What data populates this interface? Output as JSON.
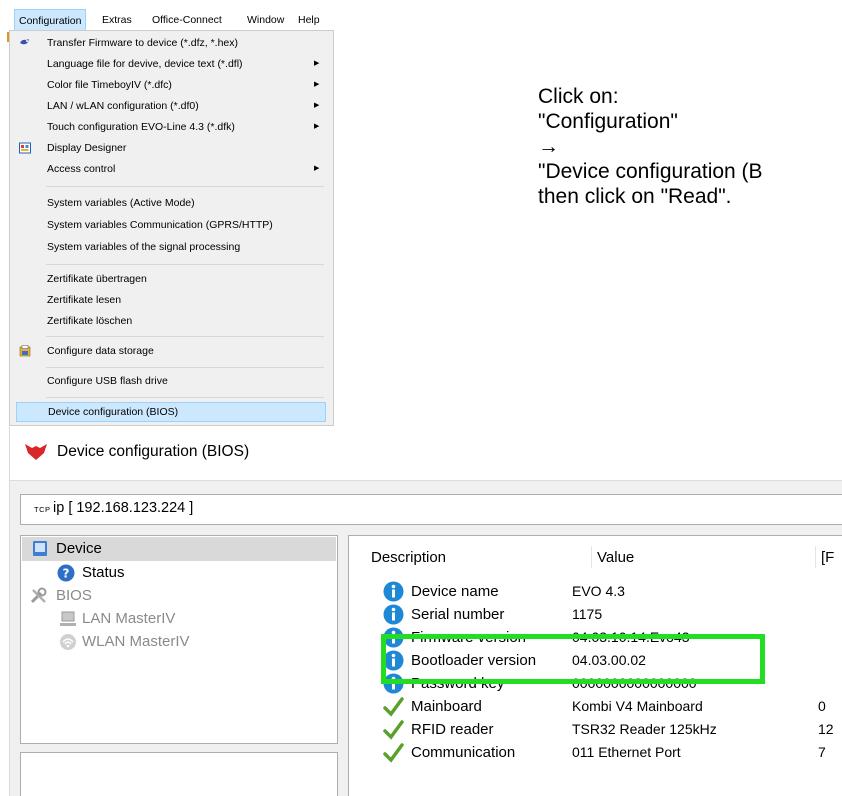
{
  "menubar": {
    "items": [
      "Configuration",
      "Extras",
      "Office-Connect",
      "Window",
      "Help"
    ]
  },
  "dropdown": {
    "items": [
      {
        "label": "Transfer Firmware to device (*.dfz, *.hex)",
        "submenu": false,
        "icon": "firmware-transfer-icon"
      },
      {
        "label": "Language file for devive, device text (*.dfl)",
        "submenu": true
      },
      {
        "label": "Color file TimeboyIV (*.dfc)",
        "submenu": true
      },
      {
        "label": "LAN / wLAN configuration (*.df0)",
        "submenu": true
      },
      {
        "label": "Touch configuration EVO-Line 4.3 (*.dfk)",
        "submenu": true
      },
      {
        "label": "Display Designer",
        "submenu": false,
        "icon": "display-designer-icon"
      },
      {
        "label": "Access control",
        "submenu": true
      },
      {
        "label": "System variables (Active Mode)",
        "submenu": false
      },
      {
        "label": "System variables Communication (GPRS/HTTP)",
        "submenu": false
      },
      {
        "label": "System variables of the signal processing",
        "submenu": false
      },
      {
        "label": "Zertifikate übertragen",
        "submenu": false
      },
      {
        "label": "Zertifikate lesen",
        "submenu": false
      },
      {
        "label": "Zertifikate löschen",
        "submenu": false
      },
      {
        "label": "Configure data storage",
        "submenu": false,
        "icon": "data-storage-icon"
      },
      {
        "label": "Configure USB flash drive",
        "submenu": false
      },
      {
        "label": "Device configuration (BIOS)",
        "submenu": false,
        "highlighted": true
      }
    ],
    "submenu_arrow": "▶"
  },
  "annotation": {
    "lines": [
      "Click on:",
      "\"Configuration\"",
      "→",
      "\"Device configuration (B",
      "then click on \"Read\"."
    ]
  },
  "dialog": {
    "title": "Device configuration (BIOS)",
    "connection": {
      "protocol": "TCP",
      "text": "ip [ 192.168.123.224 ]"
    },
    "tree": [
      {
        "label": "Device",
        "icon": "device-icon",
        "selected": true,
        "disabled": false
      },
      {
        "label": "Status",
        "icon": "help-circle-icon",
        "selected": false,
        "disabled": false
      },
      {
        "label": "BIOS",
        "icon": "tools-icon",
        "selected": false,
        "disabled": true
      },
      {
        "label": "LAN MasterIV",
        "icon": "lan-icon",
        "selected": false,
        "disabled": true
      },
      {
        "label": "WLAN MasterIV",
        "icon": "wlan-icon",
        "selected": false,
        "disabled": true
      }
    ],
    "table": {
      "headers": [
        "Description",
        "Value",
        "[F"
      ],
      "rows": [
        {
          "icon": "info-icon",
          "description": "Device name",
          "value": "EVO 4.3",
          "extra": ""
        },
        {
          "icon": "info-icon",
          "description": "Serial number",
          "value": "1175",
          "extra": ""
        },
        {
          "icon": "info-icon",
          "description": "Firmware version",
          "value": "04.03.10.14.Evo43",
          "extra": ""
        },
        {
          "icon": "info-icon",
          "description": "Bootloader version",
          "value": "04.03.00.02",
          "extra": ""
        },
        {
          "icon": "info-icon",
          "description": "Password key",
          "value": "0000000000000000",
          "extra": ""
        },
        {
          "icon": "check-icon",
          "description": "Mainboard",
          "value": "Kombi V4 Mainboard",
          "extra": "0"
        },
        {
          "icon": "check-icon",
          "description": "RFID reader",
          "value": "TSR32 Reader 125kHz",
          "extra": "12"
        },
        {
          "icon": "check-icon",
          "description": "Communication",
          "value": "011 Ethernet Port",
          "extra": "7"
        }
      ]
    }
  },
  "colors": {
    "menu_highlight": "#cce8ff",
    "highlight_box": "#22dd22",
    "info_icon": "#1e88d6",
    "check_icon": "#5aa02c",
    "logo": "#d9262b"
  }
}
